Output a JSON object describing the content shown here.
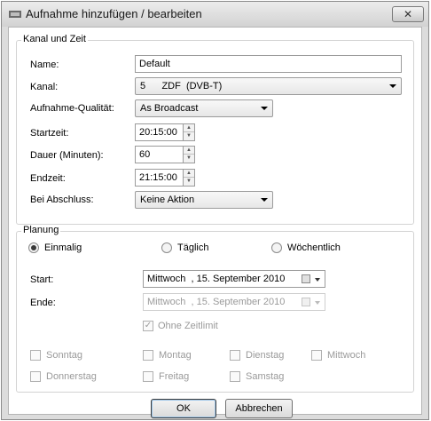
{
  "window": {
    "title": "Aufnahme hinzufügen / bearbeiten",
    "close_label": "✕"
  },
  "group_channel": {
    "title": "Kanal und Zeit",
    "name_label": "Name:",
    "name_value": "Default",
    "channel_label": "Kanal:",
    "channel_value": "5      ZDF  (DVB-T)",
    "quality_label": "Aufnahme-Qualität:",
    "quality_value": "As Broadcast",
    "start_label": "Startzeit:",
    "start_value": "20:15:00",
    "duration_label": "Dauer (Minuten):",
    "duration_value": "60",
    "end_label": "Endzeit:",
    "end_value": "21:15:00",
    "finish_label": "Bei Abschluss:",
    "finish_value": "Keine Aktion"
  },
  "group_planning": {
    "title": "Planung",
    "radio_once": "Einmalig",
    "radio_daily": "Täglich",
    "radio_weekly": "Wöchentlich",
    "start_label": "Start:",
    "start_value": "Mittwoch  , 15. September 2010",
    "end_label": "Ende:",
    "end_value": "Mittwoch  , 15. September 2010",
    "no_limit_label": "Ohne Zeitlimit",
    "days": [
      "Sonntag",
      "Montag",
      "Dienstag",
      "Mittwoch",
      "Donnerstag",
      "Freitag",
      "Samstag"
    ]
  },
  "buttons": {
    "ok": "OK",
    "cancel": "Abbrechen"
  },
  "colors": {
    "window_border": "#8a8a8a",
    "disabled_text": "#9a9a9a",
    "focus_glow": "#9bc4e8"
  }
}
